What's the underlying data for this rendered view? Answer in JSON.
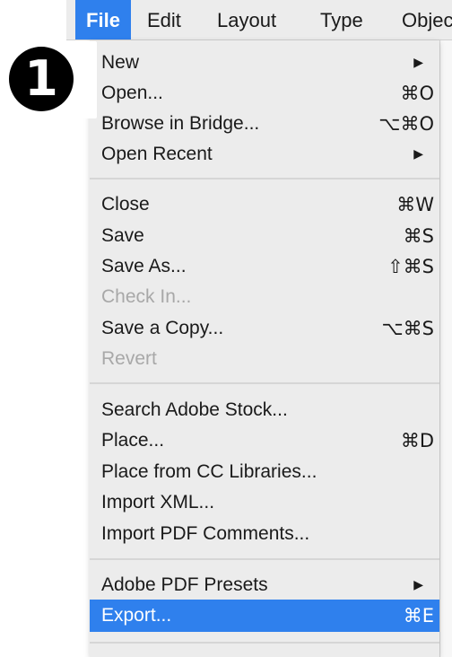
{
  "menubar": {
    "items": [
      {
        "label": "File",
        "active": true
      },
      {
        "label": "Edit"
      },
      {
        "label": "Layout"
      },
      {
        "label": "Type"
      },
      {
        "label": "Objec"
      }
    ]
  },
  "badge": {
    "text": "1"
  },
  "menu": {
    "items": [
      {
        "label": "New",
        "shortcut": "",
        "submenu": true
      },
      {
        "label": "Open...",
        "shortcut": "⌘O"
      },
      {
        "label": "Browse in Bridge...",
        "shortcut": "⌥⌘O"
      },
      {
        "label": "Open Recent",
        "shortcut": "",
        "submenu": true
      },
      {
        "label": "Close",
        "shortcut": "⌘W"
      },
      {
        "label": "Save",
        "shortcut": "⌘S"
      },
      {
        "label": "Save As...",
        "shortcut": "⇧⌘S"
      },
      {
        "label": "Check In...",
        "shortcut": "",
        "disabled": true
      },
      {
        "label": "Save a Copy...",
        "shortcut": "⌥⌘S"
      },
      {
        "label": "Revert",
        "shortcut": "",
        "disabled": true
      },
      {
        "label": "Search Adobe Stock...",
        "shortcut": ""
      },
      {
        "label": "Place...",
        "shortcut": "⌘D"
      },
      {
        "label": "Place from CC Libraries...",
        "shortcut": ""
      },
      {
        "label": "Import XML...",
        "shortcut": ""
      },
      {
        "label": "Import PDF Comments...",
        "shortcut": ""
      },
      {
        "label": "Adobe PDF Presets",
        "shortcut": "",
        "submenu": true
      },
      {
        "label": "Export...",
        "shortcut": "⌘E",
        "highlighted": true
      }
    ],
    "submenu_arrow": "▶"
  },
  "colors": {
    "highlight": "#2f80ed",
    "menu_bg": "#ececec",
    "disabled_text": "#a8a8a8"
  }
}
